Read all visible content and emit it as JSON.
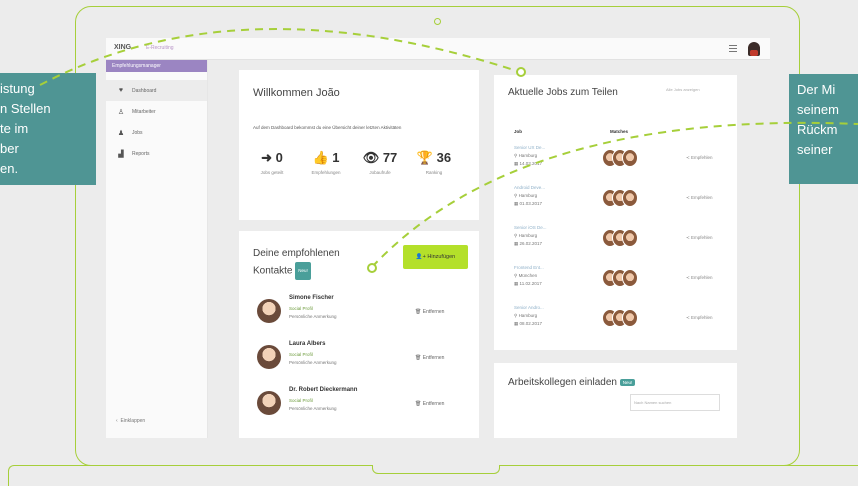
{
  "app": {
    "logo": "XING",
    "logo_sub": "E-Recruiting"
  },
  "sidebar": {
    "header": "Empfehlungsmanager",
    "items": [
      {
        "label": "Dashboard",
        "icon": "heart-icon"
      },
      {
        "label": "Mitarbeiter",
        "icon": "person-icon"
      },
      {
        "label": "Jobs",
        "icon": "person-icon"
      },
      {
        "label": "Reports",
        "icon": "chart-icon"
      }
    ],
    "bottom": "Einklappen"
  },
  "welcome": {
    "title": "Willkommen João",
    "text": "Auf dem Dashboard bekommst du eine Übersicht deiner letzten Aktivitäten",
    "stats": [
      {
        "value": "0",
        "label": "Jobs geteilt",
        "icon": "share-icon"
      },
      {
        "value": "1",
        "label": "Empfehlungen",
        "icon": "thumbs-up-icon"
      },
      {
        "value": "77",
        "label": "Jobaufrufe",
        "icon": "eye-icon"
      },
      {
        "value": "36",
        "label": "Ranking",
        "icon": "trophy-icon"
      }
    ]
  },
  "recommended": {
    "title": "Deine empfohlenen Kontakte",
    "badge": "Neu!",
    "button": "Hinzufügen",
    "remove_label": "Entfernen",
    "contacts": [
      {
        "name": "Simone Fischer",
        "line1": "Social Profil",
        "line2": "Persönliche Anmerkung"
      },
      {
        "name": "Laura Albers",
        "line1": "Social Profil",
        "line2": "Persönliche Anmerkung"
      },
      {
        "name": "Dr. Robert Dieckermann",
        "line1": "Social Profil",
        "line2": "Persönliche Anmerkung"
      }
    ]
  },
  "jobs": {
    "title": "Aktuelle Jobs zum Teilen",
    "subtitle": "Alle Jobs anzeigen",
    "col_job": "Job",
    "col_matches": "Matches",
    "share_label": "Empfehlen",
    "rows": [
      {
        "title": "Senior UX De...",
        "loc": "Hamburg",
        "date": "14.03.2017"
      },
      {
        "title": "Android Deve...",
        "loc": "Hamburg",
        "date": "01.03.2017"
      },
      {
        "title": "Senior iOS De...",
        "loc": "Hamburg",
        "date": "26.02.2017"
      },
      {
        "title": "Frontend Ent...",
        "loc": "München",
        "date": "11.02.2017"
      },
      {
        "title": "Senior Andro...",
        "loc": "Hamburg",
        "date": "08.02.2017"
      }
    ]
  },
  "invite": {
    "title": "Arbeitskollegen einladen",
    "badge": "Neu!",
    "placeholder": "Nach Namen suchen"
  },
  "callouts": {
    "left": [
      "istung",
      "n Stellen",
      "te im",
      "ber",
      "en."
    ],
    "right": [
      "Der Mi",
      "seinem",
      "Rückm",
      "seiner"
    ]
  }
}
